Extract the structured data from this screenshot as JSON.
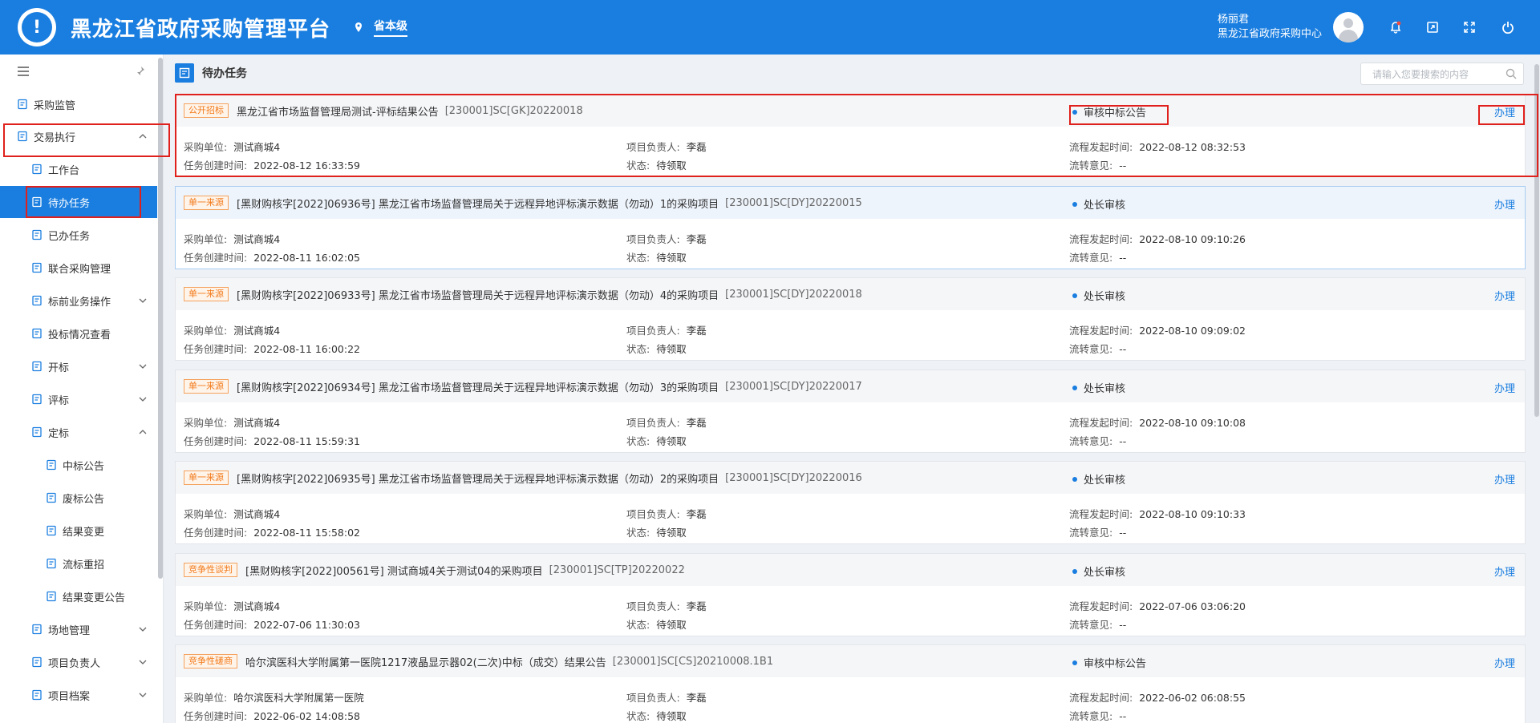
{
  "header": {
    "title": "黑龙江省政府采购管理平台",
    "location": "省本级",
    "user_name": "杨丽君",
    "user_org": "黑龙江省政府采购中心",
    "bg_color": "#1a7ee0"
  },
  "sidebar": {
    "items": [
      {
        "label": "采购监管",
        "icon": "shield-icon"
      },
      {
        "label": "交易执行",
        "icon": "clipboard-icon"
      },
      {
        "label": "工作台",
        "icon": "desktop-icon"
      },
      {
        "label": "待办任务",
        "icon": "task-icon"
      },
      {
        "label": "已办任务",
        "icon": "done-icon"
      },
      {
        "label": "联合采购管理",
        "icon": "screen-icon"
      },
      {
        "label": "标前业务操作",
        "icon": "cart-icon"
      },
      {
        "label": "投标情况查看",
        "icon": "view-icon"
      },
      {
        "label": "开标",
        "icon": "open-icon"
      },
      {
        "label": "评标",
        "icon": "evaluate-icon"
      },
      {
        "label": "定标",
        "icon": "decide-icon"
      },
      {
        "label": "中标公告",
        "icon": "notice-icon"
      },
      {
        "label": "废标公告",
        "icon": "notice-icon"
      },
      {
        "label": "结果变更",
        "icon": "change-icon"
      },
      {
        "label": "流标重招",
        "icon": "restart-icon"
      },
      {
        "label": "结果变更公告",
        "icon": "notice-icon"
      },
      {
        "label": "场地管理",
        "icon": "venue-icon"
      },
      {
        "label": "项目负责人",
        "icon": "person-icon"
      },
      {
        "label": "项目档案",
        "icon": "archive-icon"
      }
    ]
  },
  "main": {
    "title": "待办任务",
    "search_placeholder": "请输入您要搜索的内容",
    "labels": {
      "unit": "采购单位:",
      "created": "任务创建时间:",
      "leader": "项目负责人:",
      "state": "状态:",
      "flow_time": "流程发起时间:",
      "opinion": "流转意见:"
    },
    "action_label": "办理",
    "tasks": [
      {
        "tag": "公开招标",
        "title": "黑龙江省市场监督管理局测试-评标结果公告",
        "code": "[230001]SC[GK]20220018",
        "status": "审核中标公告",
        "unit": "测试商城4",
        "created": "2022-08-12 16:33:59",
        "leader": "李磊",
        "state": "待领取",
        "flow_time": "2022-08-12 08:32:53",
        "opinion": "--"
      },
      {
        "tag": "单一来源",
        "title": "[黑财购核字[2022]06936号] 黑龙江省市场监督管理局关于远程异地评标演示数据（勿动）1的采购项目",
        "code": "[230001]SC[DY]20220015",
        "status": "处长审核",
        "unit": "测试商城4",
        "created": "2022-08-11 16:02:05",
        "leader": "李磊",
        "state": "待领取",
        "flow_time": "2022-08-10 09:10:26",
        "opinion": "--"
      },
      {
        "tag": "单一来源",
        "title": "[黑财购核字[2022]06933号] 黑龙江省市场监督管理局关于远程异地评标演示数据（勿动）4的采购项目",
        "code": "[230001]SC[DY]20220018",
        "status": "处长审核",
        "unit": "测试商城4",
        "created": "2022-08-11 16:00:22",
        "leader": "李磊",
        "state": "待领取",
        "flow_time": "2022-08-10 09:09:02",
        "opinion": "--"
      },
      {
        "tag": "单一来源",
        "title": "[黑财购核字[2022]06934号] 黑龙江省市场监督管理局关于远程异地评标演示数据（勿动）3的采购项目",
        "code": "[230001]SC[DY]20220017",
        "status": "处长审核",
        "unit": "测试商城4",
        "created": "2022-08-11 15:59:31",
        "leader": "李磊",
        "state": "待领取",
        "flow_time": "2022-08-10 09:10:08",
        "opinion": "--"
      },
      {
        "tag": "单一来源",
        "title": "[黑财购核字[2022]06935号] 黑龙江省市场监督管理局关于远程异地评标演示数据（勿动）2的采购项目",
        "code": "[230001]SC[DY]20220016",
        "status": "处长审核",
        "unit": "测试商城4",
        "created": "2022-08-11 15:58:02",
        "leader": "李磊",
        "state": "待领取",
        "flow_time": "2022-08-10 09:10:33",
        "opinion": "--"
      },
      {
        "tag": "竞争性谈判",
        "title": "[黑财购核字[2022]00561号] 测试商城4关于测试04的采购项目",
        "code": "[230001]SC[TP]20220022",
        "status": "处长审核",
        "unit": "测试商城4",
        "created": "2022-07-06 11:30:03",
        "leader": "李磊",
        "state": "待领取",
        "flow_time": "2022-07-06 03:06:20",
        "opinion": "--"
      },
      {
        "tag": "竞争性磋商",
        "title": "哈尔滨医科大学附属第一医院1217液晶显示器02(二次)中标（成交）结果公告",
        "code": "[230001]SC[CS]20210008.1B1",
        "status": "审核中标公告",
        "unit": "哈尔滨医科大学附属第一医院",
        "created": "2022-06-02 14:08:58",
        "leader": "李磊",
        "state": "待领取",
        "flow_time": "2022-06-02 06:08:55",
        "opinion": "--"
      }
    ]
  }
}
